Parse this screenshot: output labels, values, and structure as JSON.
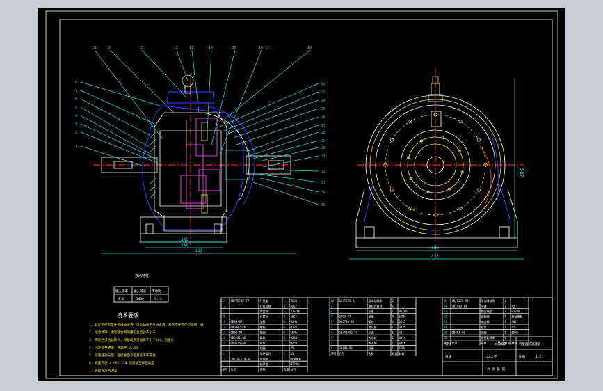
{
  "drawing": {
    "section_heading": "技术要求",
    "notes": [
      "1. 装配前所有零件用煤油清洗，滚动轴承用汽油清洗，机内不许有任何杂物，机",
      "2. 啮合侧隙，齿轮啮合侧隙用铅丝检验不小于",
      "3. 用涂色法检验斑点，接触斑点沿齿高不小于40%，沿齿长",
      "4. 固定调整轴承，并调整 0.1mm",
      "5. 减速器剖分面，各接触面及密封处不许漏油。",
      "6. 机座内装 L-CKC 150 润滑油至规定高度",
      "7. 表面涂灰色油漆"
    ],
    "table_caption": "技术特性",
    "spec_headers": [
      "输入功率",
      "输入转速",
      "传动比"
    ],
    "spec_values": [
      "4.0",
      "1450",
      "9.25"
    ],
    "balloons": [
      "19",
      "10",
      "13",
      "12",
      "11",
      "14",
      "15",
      "16-17",
      "18",
      "8",
      "7",
      "6",
      "5",
      "4",
      "3",
      "2",
      "1",
      "22",
      "23",
      "24",
      "25",
      "26",
      "27",
      "28",
      "29",
      "30",
      "31",
      "32",
      "33",
      "34",
      "35"
    ],
    "dims": {
      "length_total": "683",
      "bottom_a": "326",
      "bottom_b": "280",
      "height": "587",
      "side_width": "433",
      "side_inner": "380"
    }
  },
  "bom": {
    "left_rows": [
      [
        "23",
        "GB/T5782-77",
        "行星架",
        "1",
        "ZG35"
      ],
      [
        "22",
        "",
        "行星轮轴",
        "3",
        "40Cr"
      ],
      [
        "21",
        "",
        "内齿轮",
        "1",
        "42SiMn"
      ],
      [
        "20",
        "",
        "行星轮",
        "3",
        "40Cr"
      ],
      [
        "19",
        "GB93-87",
        "垫圈",
        "6",
        "65Mn"
      ],
      [
        "18",
        "GB5782-86",
        "螺栓",
        "6",
        "Q235"
      ],
      [
        "17",
        "GB93-87",
        "垫圈",
        "6",
        "65Mn"
      ],
      [
        "16",
        "GB5782-86",
        "螺栓",
        "6",
        "Q235"
      ],
      [
        "15",
        "GB6170-86",
        "螺母",
        "1",
        "Q235"
      ],
      [
        "14",
        "",
        "挡圈",
        "1",
        "45"
      ],
      [
        "13",
        "",
        "吊环螺钉",
        "1",
        "45"
      ],
      [
        "12",
        "JB/T8-129-86",
        "密封圈",
        "1",
        "耐油橡胶"
      ],
      [
        "11",
        "",
        "轴承盖",
        "1",
        "HT200"
      ]
    ],
    "mid_rows": [
      [
        "10",
        "GB/T276-94",
        "深沟球轴承",
        "2",
        ""
      ],
      [
        "9",
        "",
        "油标尺组件",
        "1",
        ""
      ],
      [
        "8",
        "",
        "机座",
        "1",
        "HT200"
      ],
      [
        "7",
        "GB93-87",
        "垫圈",
        "4",
        "65Mn"
      ],
      [
        "6",
        "GB5788-86",
        "螺栓",
        "4",
        "Q235"
      ],
      [
        "5",
        "",
        "透气塞",
        "1",
        "Q235"
      ],
      [
        "4",
        "GB/T1096-79",
        "平键",
        "1",
        "45"
      ],
      [
        "3",
        "",
        "太阳轮",
        "1",
        "40Cr"
      ],
      [
        "2",
        "",
        "输入轴",
        "1",
        "40Cr"
      ],
      [
        "1",
        "GB893-86",
        "挡圈",
        "1",
        "65Mn"
      ]
    ],
    "right_rows": [
      [
        "35",
        "GB/T276-94",
        "深沟球轴承",
        "2",
        ""
      ],
      [
        "34",
        "GB1096-79",
        "平键",
        "1",
        "45"
      ],
      [
        "33",
        "",
        "输出端盖",
        "1",
        "HT200"
      ],
      [
        "32",
        "",
        "密封圈",
        "1",
        "耐油橡胶"
      ],
      [
        "31",
        "",
        "输出轴",
        "1",
        "40Cr"
      ],
      [
        "30",
        "",
        "套筒",
        "1",
        "45"
      ],
      [
        "29",
        "GB893-86",
        "挡圈",
        "1",
        "65Mn"
      ],
      [
        "28",
        "",
        "行星轮轴承",
        "6",
        ""
      ]
    ],
    "header_row": [
      "序号",
      "代号",
      "名称",
      "数量",
      "材料",
      "备注"
    ],
    "title_block": {
      "name": "装配图",
      "project": "行星齿轮减速器",
      "scale_label": "比例",
      "scale": "1:2",
      "sheet_label": "共 张 第 张",
      "school": "XX大学",
      "drawn_label": "设计",
      "checked_label": "审核"
    }
  }
}
